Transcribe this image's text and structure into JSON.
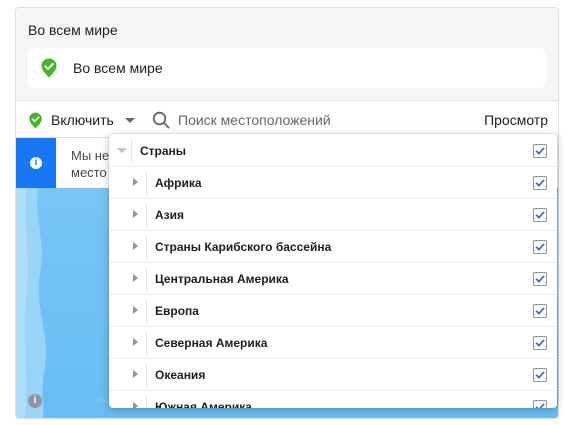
{
  "header": {
    "title": "Во всем мире",
    "selected_location": "Во всем мире"
  },
  "toolbar": {
    "include_label": "Включить",
    "search_placeholder": "Поиск местоположений",
    "browse_label": "Просмотр"
  },
  "banner": {
    "text": "Мы не\nместо"
  },
  "dropdown": {
    "root_label": "Страны",
    "root_checked": true,
    "regions": [
      {
        "label": "Африка",
        "checked": true
      },
      {
        "label": "Азия",
        "checked": true
      },
      {
        "label": "Страны Карибского бассейна",
        "checked": true
      },
      {
        "label": "Центральная Америка",
        "checked": true
      },
      {
        "label": "Европа",
        "checked": true
      },
      {
        "label": "Северная Америка",
        "checked": true
      },
      {
        "label": "Океания",
        "checked": true
      },
      {
        "label": "Южная Америка",
        "checked": true
      }
    ]
  },
  "colors": {
    "accent": "#1877f2",
    "check_green": "#42b72a",
    "map_water": "#7cc7f7",
    "checkbox_check": "#4267b2"
  },
  "icons": {
    "location_status": "green-check-shield-icon",
    "search": "magnifier-icon",
    "info": "info-icon",
    "expand": "triangle-right-icon",
    "collapse": "triangle-down-icon"
  }
}
